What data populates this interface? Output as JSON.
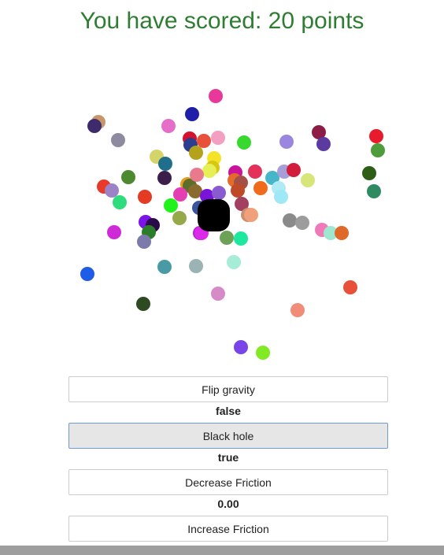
{
  "header": {
    "score_text": "You have scored: 20 points"
  },
  "controls": {
    "flip_gravity": {
      "label": "Flip gravity",
      "value": "false"
    },
    "black_hole": {
      "label": "Black hole",
      "value": "true"
    },
    "decrease_friction": {
      "label": "Decrease Friction"
    },
    "friction_value": "0.00",
    "increase_friction": {
      "label": "Increase Friction"
    }
  },
  "colors": {
    "title": "#2e7d32",
    "black_hole": "#000000"
  }
}
